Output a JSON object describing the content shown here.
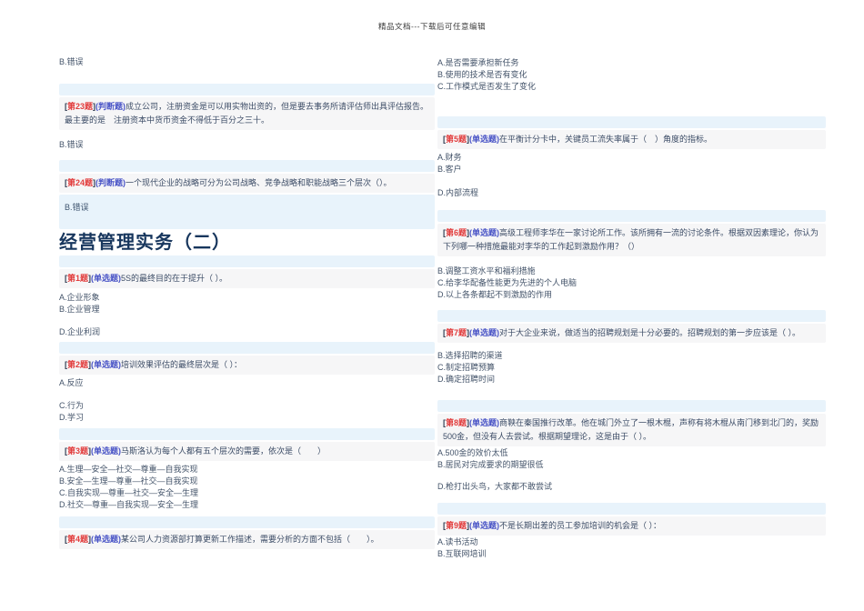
{
  "tokens": {
    "lbracket": "[",
    "rbracket": "]"
  },
  "colors": {
    "bar_blue": "#e8f3fb",
    "question_row_bg": "#f6f6f7",
    "number_red": "#e23d3d",
    "type_blue": "#4853c6",
    "body_text": "#3c4c66",
    "heading_navy": "#17365d"
  },
  "header": {
    "watermark": "精品文档---下载后可任意编辑"
  },
  "section": {
    "title": "经营管理实务（二）"
  },
  "left": {
    "prev_answer": "B.错误",
    "q23": {
      "num": "第23题",
      "type_label": "(判断题)",
      "text": "成立公司，注册资金是可以用实物出资的，但是要去事务所请评估师出具评估报告。最主要的是　注册资本中货币资金不得低于百分之三十。"
    },
    "q23_answer": "B.错误",
    "q24": {
      "num": "第24题",
      "type_label": "(判断题)",
      "text": "一个现代企业的战略可分为公司战略、竞争战略和职能战略三个层次（）。"
    },
    "q24_answer": "B.错误",
    "q1": {
      "num": "第1题",
      "type_label": "(单选题)",
      "text": "5S的最终目的在于提升（ ）。",
      "options": [
        "A.企业形象",
        "B.企业管理",
        "D.企业利润"
      ]
    },
    "q2": {
      "num": "第2题",
      "type_label": "(单选题)",
      "text": "培训效果评估的最终层次是（ ）：",
      "options": [
        "A.反应",
        "C.行为",
        "D.学习"
      ]
    },
    "q3": {
      "num": "第3题",
      "type_label": "(单选题)",
      "text": "马斯洛认为每个人都有五个层次的需要，依次是（　　）",
      "options": [
        "A.生理—安全—社交—尊重—自我实现",
        "B.安全—生理—尊重—社交—自我实现",
        "C.自我实现—尊重—社交—安全—生理",
        "D.社交—尊重—自我实现—安全—生理"
      ]
    },
    "q4": {
      "num": "第4题",
      "type_label": "(单选题)",
      "text": "某公司人力资源部打算更新工作描述，需要分析的方面不包括（　　）。"
    }
  },
  "right": {
    "q4_options": [
      "A.是否需要承担新任务",
      "B.使用的技术是否有变化",
      "C.工作模式是否发生了变化"
    ],
    "q5": {
      "num": "第5题",
      "type_label": "(单选题)",
      "text": "在平衡计分卡中，关键员工流失率属于（　）角度的指标。",
      "options": [
        "A.财务",
        "B.客户"
      ],
      "option_d": "D.内部流程"
    },
    "q6": {
      "num": "第6题",
      "type_label": "(单选题)",
      "text": "高级工程师李华在一家讨论所工作。该所拥有一流的讨论条件。根据双因素理论，你认为下列哪一种措施最能对李华的工作起到激励作用？（）",
      "options": [
        "B.调整工资水平和福利措施",
        "C.给李华配备性能更为先进的个人电脑",
        "D.以上各条都起不到激励的作用"
      ]
    },
    "q7": {
      "num": "第7题",
      "type_label": "(单选题)",
      "text": "对于大企业来说，做适当的招聘规划是十分必要的。招聘规划的第一步应该是（ ）。",
      "options": [
        "B.选择招聘的渠道",
        "C.制定招聘预算",
        "D.确定招聘时间"
      ]
    },
    "q8": {
      "num": "第8题",
      "type_label": "(单选题)",
      "text": "商鞅在秦国推行改革。他在城门外立了一根木棍，声称有将木棍从南门移到北门的，奖励500金，但没有人去尝试。根据期望理论，这是由于（ ）。",
      "options": [
        "A.500金的效价太低",
        "B.居民对完成要求的期望很低",
        "D.枪打出头鸟，大家都不敢尝试"
      ]
    },
    "q9": {
      "num": "第9题",
      "type_label": "(单选题)",
      "text": "不是长期出差的员工参加培训的机会是（ ）：",
      "options": [
        "A.读书活动",
        "B.互联网培训"
      ]
    }
  }
}
